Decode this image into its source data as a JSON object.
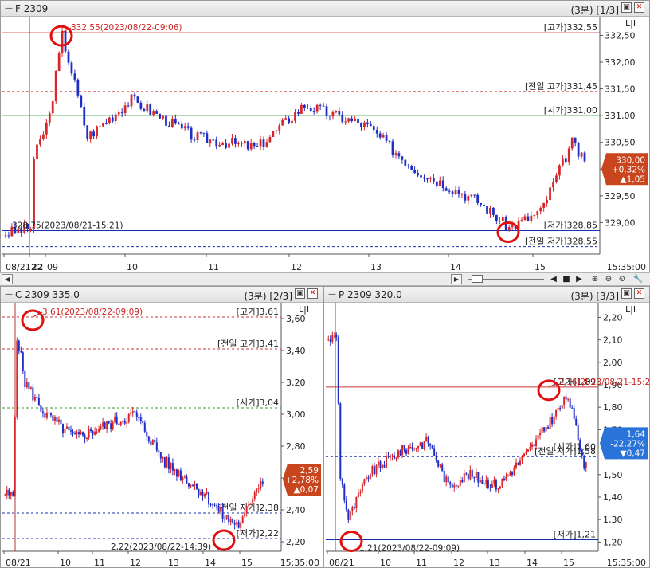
{
  "top_panel": {
    "title": "F 2309",
    "right_label": "(3분) [1/3]",
    "price_labels": [
      "332,50",
      "332,00",
      "331,50",
      "331,00",
      "330,50",
      "330,00",
      "329,50",
      "329,00"
    ],
    "refs": {
      "high": "[고가]332,55",
      "prev_high": "[전일 고가]331,45",
      "open": "[시가]331,00",
      "low": "[저가]328,85",
      "prev_low": "[전일 저가]328,55"
    },
    "max_note": "332,55(2023/08/22-09:06)",
    "min_note": "328,75(2023/08/21-15:21)",
    "current": {
      "price": "330,00",
      "pct": "+0,32%",
      "chg": "▲1,05",
      "color": "#c8451e"
    },
    "time_labels": [
      "08/21",
      "22",
      "09",
      "10",
      "11",
      "12",
      "13",
      "14",
      "15"
    ],
    "end_time": "15:35:00"
  },
  "scroll": {
    "left": "◀",
    "right": "▶"
  },
  "left_panel": {
    "title": "C 2309 335.0",
    "right_label": "(3분) [2/3]",
    "price_labels": [
      "3,60",
      "3,40",
      "3,20",
      "3,00",
      "2,80",
      "2,60",
      "2,40",
      "2,20"
    ],
    "refs": {
      "high": "[고가]3,61",
      "prev_high": "[전일 고가]3,41",
      "open": "[시가]3,04",
      "prev_low": "[전일 저가]2,38",
      "low": "[저가]2,22"
    },
    "max_note": "3,61(2023/08/22-09:09)",
    "min_note": "2,22(2023/08/22-14:39)",
    "current": {
      "price": "2,59",
      "pct": "+2,78%",
      "chg": "▲0,07",
      "color": "#c8451e"
    },
    "time_labels": [
      "08/21",
      "10",
      "11",
      "12",
      "13",
      "14",
      "15"
    ],
    "end_time": "15:35:00"
  },
  "right_panel": {
    "title": "P 2309 320.0",
    "right_label": "(3분) [3/3]",
    "price_labels": [
      "2,20",
      "2,10",
      "2,00",
      "1,90",
      "1,80",
      "1,70",
      "1,60",
      "1,50",
      "1,40",
      "1,30",
      "1,20"
    ],
    "refs": {
      "high": "[고가]1,89",
      "open": "[시가]1,60",
      "prev_low": "[전일 저가]1,58",
      "low": "[저가]1,21"
    },
    "max_note": "2,16(2023/08/21-15:21)",
    "min_note": "1,21(2023/08/22-09:09)",
    "current": {
      "price": "1,64",
      "pct": "-22,27%",
      "chg": "▼0,47",
      "color": "#2a73d8"
    },
    "time_labels": [
      "08/21",
      "10",
      "11",
      "12",
      "13",
      "14",
      "15"
    ],
    "end_time": "15:35:00"
  },
  "colors": {
    "up": "#d9262b",
    "down": "#1f2ec4",
    "ref_red": "#c33",
    "ref_green": "#2a9a2a",
    "ref_blue": "#1a2fb0",
    "marker": "#e01010"
  }
}
